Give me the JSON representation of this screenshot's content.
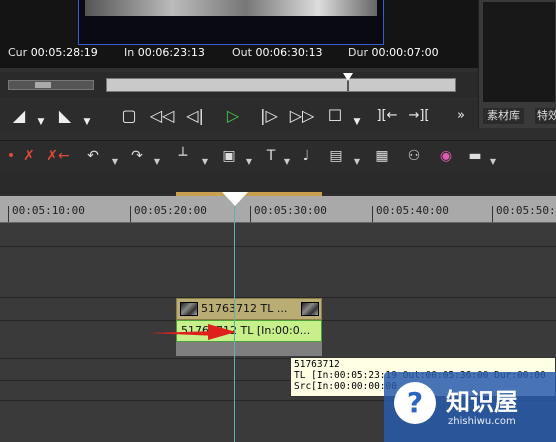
{
  "timecodes": {
    "cur_label": "Cur",
    "cur_value": "00:05:28:19",
    "in_label": "In",
    "in_value": "00:06:23:13",
    "out_label": "Out",
    "out_value": "00:06:30:13",
    "dur_label": "Dur",
    "dur_value": "00:00:07:00"
  },
  "right_panel": {
    "tab_library": "素材库",
    "tab_effects": "特效"
  },
  "ruler": {
    "labels": [
      "00:05:10:00",
      "00:05:20:00",
      "00:05:30:00",
      "00:05:40:00",
      "00:05:50:0"
    ]
  },
  "clips": {
    "video_title": "51763712  TL ...",
    "audio_title": "51763712  TL [In:00:0..."
  },
  "tooltip": {
    "line1": "51763712",
    "line2": "TL [In:00:05:23:19 Out:00:05:36:00 Dur:00:00",
    "line3": "Src[In:00:00:00:00"
  },
  "watermark": {
    "logo_glyph": "?",
    "name": "知识屋",
    "domain": "zhishiwu.com"
  },
  "icons": {
    "transport": [
      "mark-in-icon",
      "mark-out-icon",
      "stop-icon",
      "rewind-icon",
      "step-back-icon",
      "play-icon",
      "step-forward-icon",
      "fast-forward-icon",
      "loop-icon",
      "match-in-icon",
      "match-out-icon",
      "more-icon"
    ],
    "toolbar": [
      "cut-icon",
      "delete-icon",
      "undo-icon",
      "redo-icon",
      "split-icon",
      "insert-icon",
      "title-icon",
      "mic-icon",
      "effect-icon",
      "grid-icon",
      "mixer-icon",
      "color-icon",
      "display-icon"
    ]
  },
  "colors": {
    "accent_play": "#4ac34a",
    "clip_video": "#b9ad73",
    "clip_audio": "#c7f08a",
    "playhead": "#5ab3b0",
    "arrow": "#e0201c"
  }
}
